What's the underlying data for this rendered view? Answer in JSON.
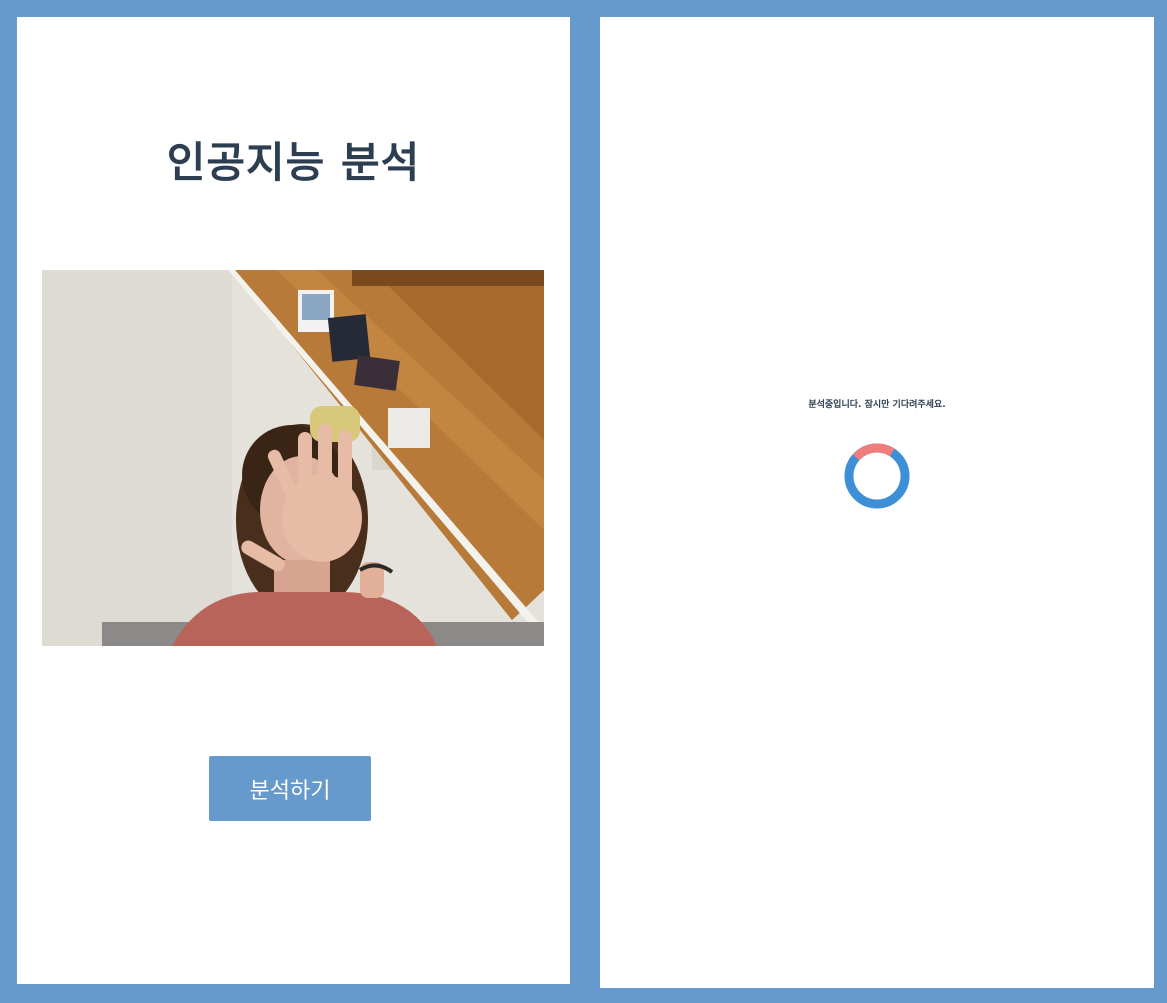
{
  "left_screen": {
    "title": "인공지능 분석",
    "camera_icon": "webcam-preview",
    "analyze_button_label": "분석하기"
  },
  "right_screen": {
    "status_message": "분석중입니다. 잠시만 기다려주세요.",
    "spinner_icon": "loading-spinner-icon"
  },
  "colors": {
    "frame": "#6699cc",
    "button": "#6699cc",
    "title": "#2d3e50",
    "spinner_primary": "#3d8fd8",
    "spinner_accent": "#f07c7c"
  }
}
